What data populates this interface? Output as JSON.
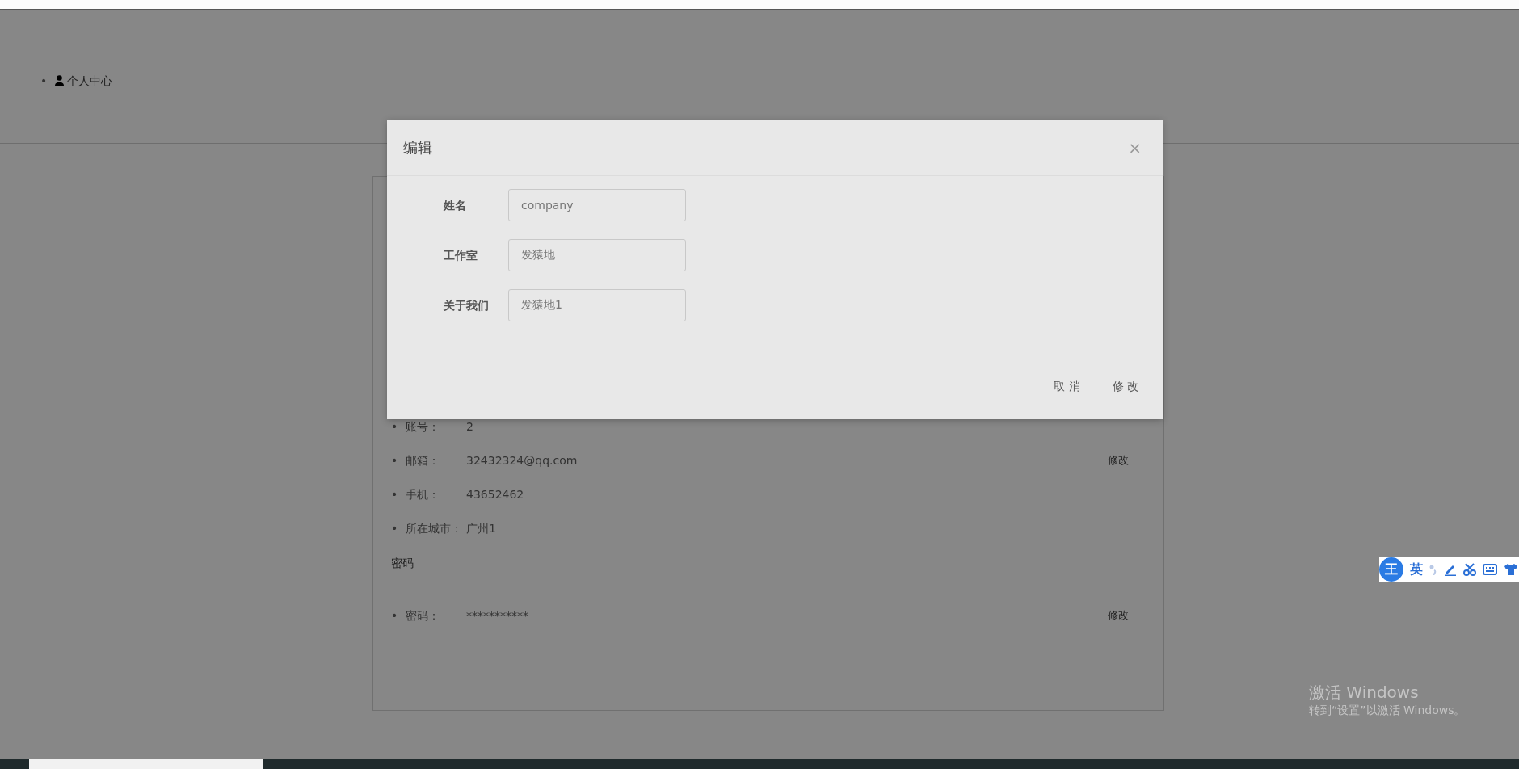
{
  "top_nav": {
    "items": [
      {
        "marker": "•",
        "label": "个人中心"
      }
    ]
  },
  "sections": [
    {
      "items": [
        {
          "marker": "•",
          "label": "账号：",
          "value": "2"
        },
        {
          "marker": "•",
          "label": "邮箱：",
          "value": "32432324@qq.com",
          "action": "修改"
        },
        {
          "marker": "•",
          "label": "手机：",
          "value": "43652462"
        },
        {
          "marker": "•",
          "label": "所在城市：",
          "value": "广州1"
        }
      ]
    },
    {
      "title": "密码",
      "items": [
        {
          "marker": "•",
          "label": "密码：",
          "value": "***********",
          "action": "修改"
        }
      ]
    }
  ],
  "modal": {
    "title": "编辑",
    "close": "×",
    "fields": [
      {
        "label": "姓名",
        "value": "company"
      },
      {
        "label": "工作室",
        "value": "发猿地"
      },
      {
        "label": "关于我们",
        "value": "发猿地1"
      }
    ],
    "buttons": [
      "取 消",
      "修 改"
    ]
  },
  "ime_toolbar": {
    "logo": "王",
    "mode": "英"
  },
  "activation_notice": {
    "title": "激活 Windows",
    "text": "转到“设置”以激活 Windows。"
  }
}
